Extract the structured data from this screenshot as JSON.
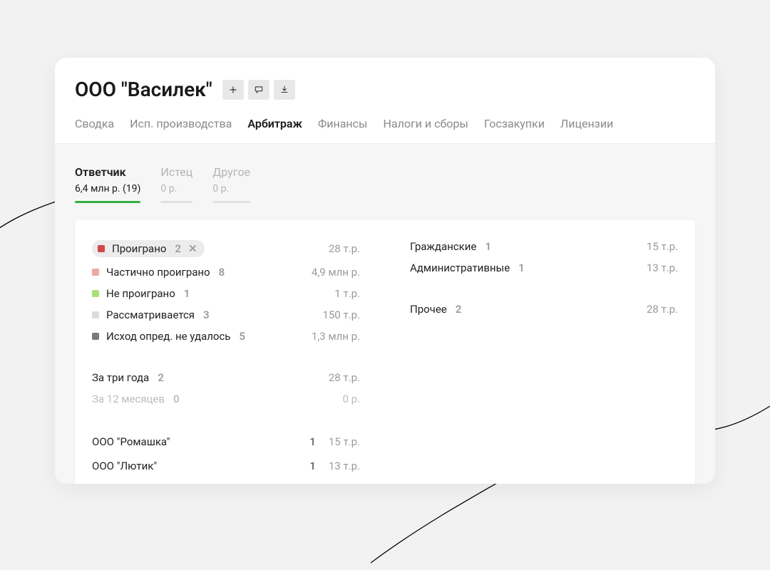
{
  "header": {
    "title": "ООО \"Василек\""
  },
  "top_tabs": [
    {
      "label": "Сводка",
      "active": false
    },
    {
      "label": "Исп. производства",
      "active": false
    },
    {
      "label": "Арбитраж",
      "active": true
    },
    {
      "label": "Финансы",
      "active": false
    },
    {
      "label": "Налоги и сборы",
      "active": false
    },
    {
      "label": "Госзакупки",
      "active": false
    },
    {
      "label": "Лицензии",
      "active": false
    }
  ],
  "sub_tabs": [
    {
      "label": "Ответчик",
      "value": "6,4 млн р. (19)",
      "active": true
    },
    {
      "label": "Истец",
      "value": "0 р.",
      "active": false
    },
    {
      "label": "Другое",
      "value": "0 р.",
      "active": false
    }
  ],
  "colors": {
    "lost": "#d64545",
    "partial": "#f0a6a6",
    "not_lost": "#a8e07a",
    "pending": "#dcdcdc",
    "unknown": "#7a7a7a"
  },
  "outcomes": [
    {
      "key": "lost",
      "label": "Проиграно",
      "count": "2",
      "amount": "28 т.р.",
      "selected": true
    },
    {
      "key": "partial",
      "label": "Частично проиграно",
      "count": "8",
      "amount": "4,9 млн р."
    },
    {
      "key": "not_lost",
      "label": "Не проиграно",
      "count": "1",
      "amount": "1 т.р."
    },
    {
      "key": "pending",
      "label": "Рассматривается",
      "count": "3",
      "amount": "150 т.р."
    },
    {
      "key": "unknown",
      "label": "Исход опред. не удалось",
      "count": "5",
      "amount": "1,3 млн р."
    }
  ],
  "periods": [
    {
      "label": "За три года",
      "count": "2",
      "amount": "28 т.р.",
      "muted": false
    },
    {
      "label": "За 12 месяцев",
      "count": "0",
      "amount": "0 р.",
      "muted": true
    }
  ],
  "orgs": [
    {
      "name": "ООО \"Ромашка\"",
      "count": "1",
      "amount": "15 т.р."
    },
    {
      "name": "ООО \"Лютик\"",
      "count": "1",
      "amount": "13 т.р."
    }
  ],
  "categories_top": [
    {
      "label": "Гражданские",
      "count": "1",
      "amount": "15 т.р."
    },
    {
      "label": "Административные",
      "count": "1",
      "amount": "13 т.р."
    }
  ],
  "categories_other": [
    {
      "label": "Прочее",
      "count": "2",
      "amount": "28 т.р."
    }
  ]
}
